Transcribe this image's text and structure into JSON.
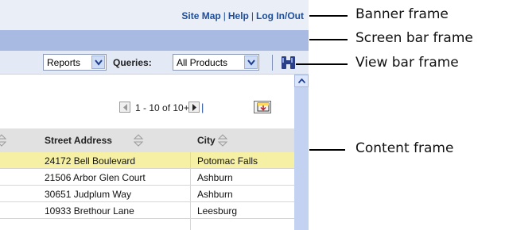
{
  "banner": {
    "links": [
      "Site Map",
      "Help",
      "Log In/Out"
    ]
  },
  "viewbar": {
    "reports_select": "Reports",
    "queries_label": "Queries:",
    "queries_select": "All Products"
  },
  "pager": {
    "range_text": "1 - 10 of 10+"
  },
  "table": {
    "columns": [
      "Street Address",
      "City"
    ],
    "rows": [
      [
        "24172 Bell Boulevard",
        "Potomac Falls"
      ],
      [
        "21506 Arbor Glen Court",
        "Ashburn"
      ],
      [
        "30651 Judplum Way",
        "Ashburn"
      ],
      [
        "10933 Brethour Lane",
        "Leesburg"
      ]
    ]
  },
  "callouts": {
    "banner": "Banner frame",
    "screenbar": "Screen bar frame",
    "viewbar": "View bar frame",
    "content": "Content frame"
  },
  "colors": {
    "banner_bg": "#e9eef7",
    "screenbar_bg": "#a8b9e2",
    "viewbar_bg": "#e4eaf5",
    "link": "#1f4e9b",
    "highlight_row": "#f5f0a3",
    "scrollbar": "#c4d2f1"
  }
}
